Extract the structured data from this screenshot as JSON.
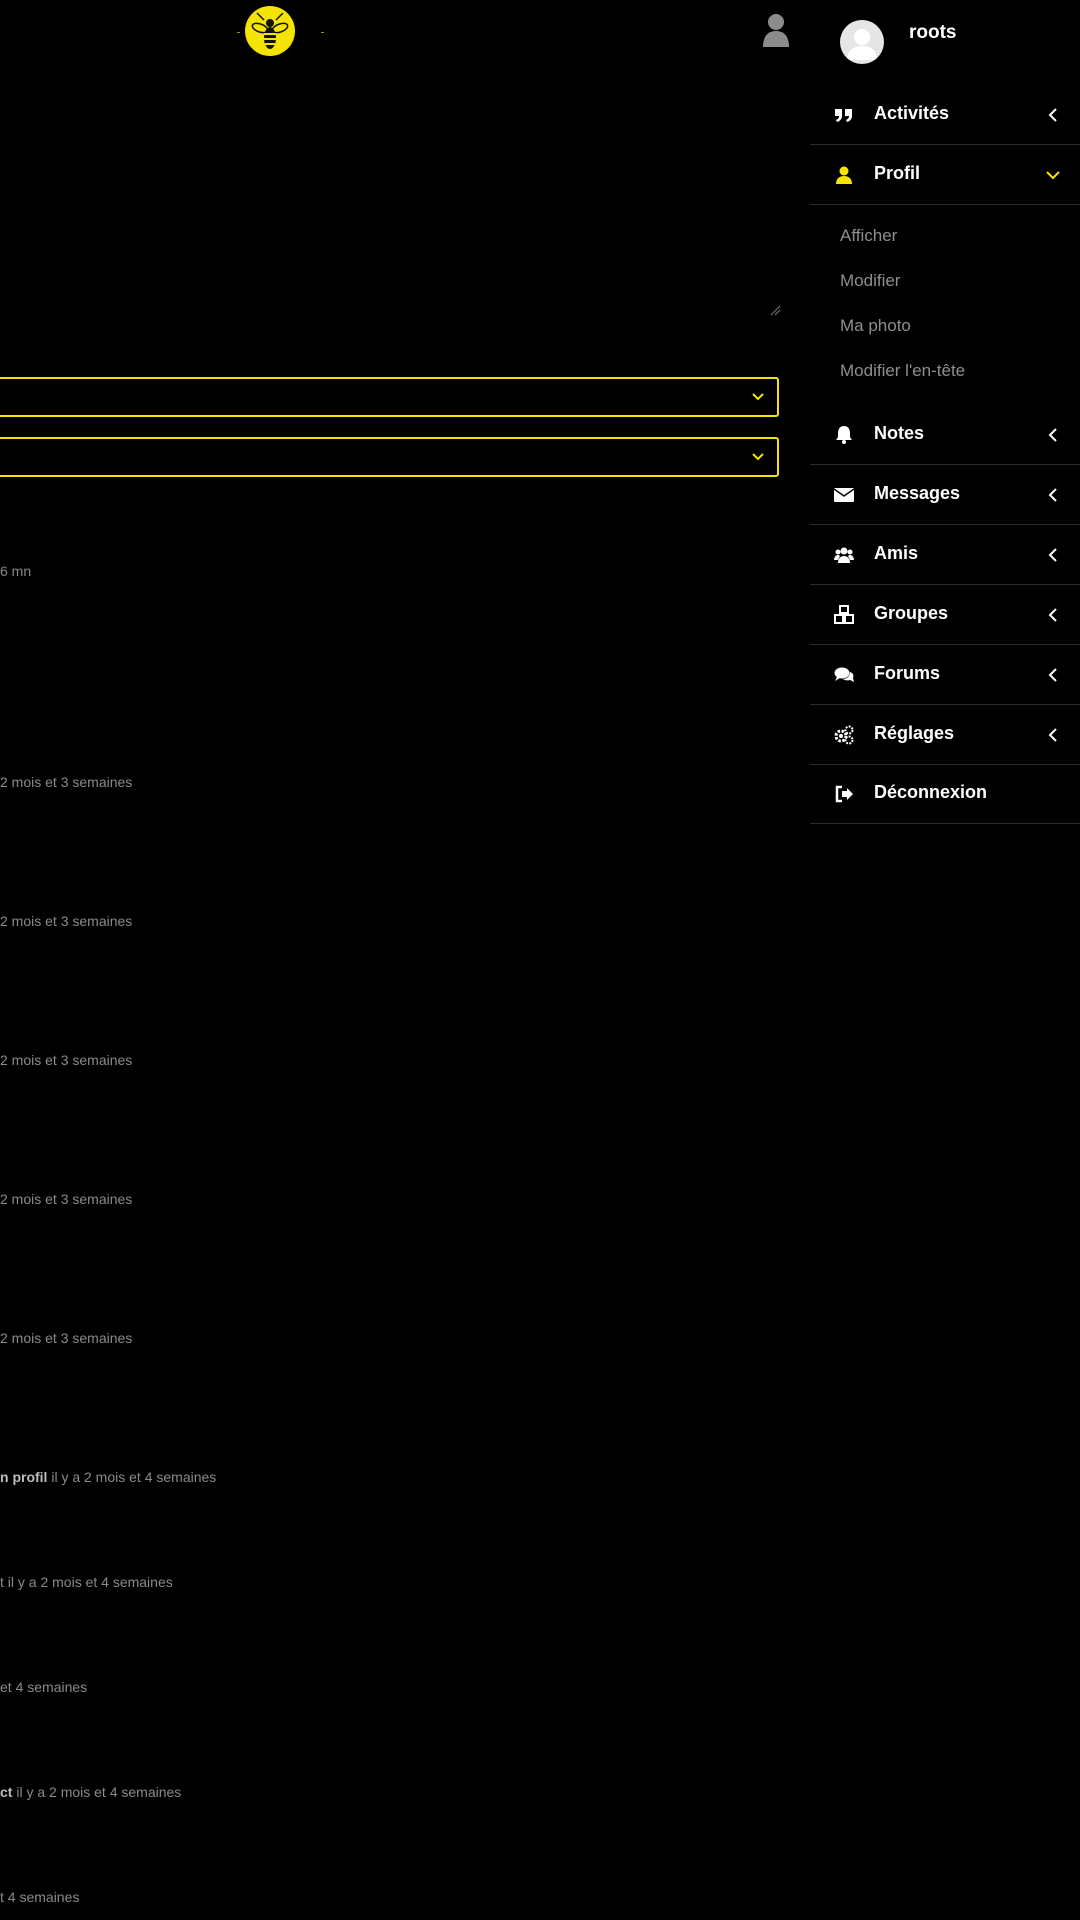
{
  "header": {
    "logo_icon": "bee-logo-icon",
    "user_icon": "user-icon"
  },
  "main": {
    "timestamps": [
      {
        "bold": "",
        "text": "6 mn"
      },
      {
        "bold": "",
        "text": "2 mois et 3 semaines"
      },
      {
        "bold": "",
        "text": "2 mois et 3 semaines"
      },
      {
        "bold": "",
        "text": "2 mois et 3 semaines"
      },
      {
        "bold": "",
        "text": "2 mois et 3 semaines"
      },
      {
        "bold": "",
        "text": "2 mois et 3 semaines"
      },
      {
        "bold": "n profil",
        "text": " il y a 2 mois et 4 semaines"
      },
      {
        "bold": "",
        "text": "t il y a 2 mois et 4 semaines"
      },
      {
        "bold": "",
        "text": "et 4 semaines"
      },
      {
        "bold": "ct",
        "text": " il y a 2 mois et 4 semaines"
      },
      {
        "bold": "",
        "text": "t 4 semaines"
      }
    ]
  },
  "sidebar": {
    "username": "roots",
    "items": [
      {
        "label": "Activités",
        "icon": "quote-icon"
      },
      {
        "label": "Profil",
        "icon": "user-icon"
      },
      {
        "label": "Notes",
        "icon": "bell-icon"
      },
      {
        "label": "Messages",
        "icon": "envelope-icon"
      },
      {
        "label": "Amis",
        "icon": "users-icon"
      },
      {
        "label": "Groupes",
        "icon": "cubes-icon"
      },
      {
        "label": "Forums",
        "icon": "comments-icon"
      },
      {
        "label": "Réglages",
        "icon": "gears-icon"
      },
      {
        "label": "Déconnexion",
        "icon": "sign-out-icon"
      }
    ],
    "profile_submenu": [
      "Afficher",
      "Modifier",
      "Ma photo",
      "Modifier l'en-tête"
    ]
  },
  "colors": {
    "accent": "#f5e400",
    "background": "#000000",
    "muted_text": "#8a8a8a"
  }
}
